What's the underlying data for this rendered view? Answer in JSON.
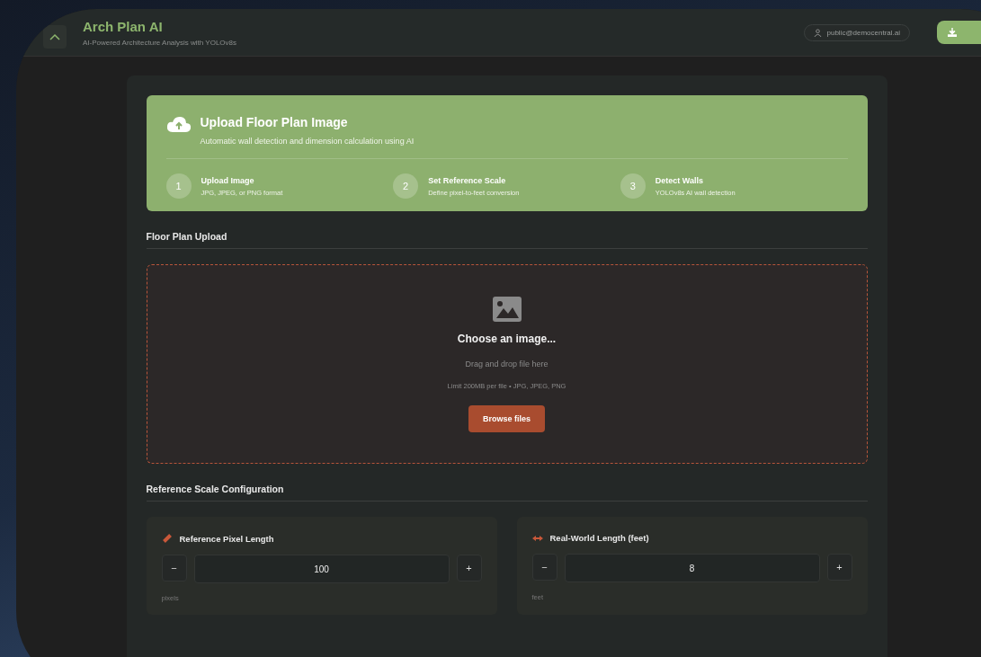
{
  "header": {
    "title": "Arch Plan AI",
    "subtitle": "AI-Powered Architecture Analysis with YOLOv8s",
    "user": "public@democentral.ai"
  },
  "hero": {
    "title": "Upload Floor Plan Image",
    "subtitle": "Automatic wall detection and dimension calculation using AI",
    "steps": [
      {
        "number": "1",
        "title": "Upload Image",
        "detail": "JPG, JPEG, or PNG format"
      },
      {
        "number": "2",
        "title": "Set Reference Scale",
        "detail": "Define pixel-to-feet conversion"
      },
      {
        "number": "3",
        "title": "Detect Walls",
        "detail": "YOLOv8s AI wall detection"
      }
    ]
  },
  "upload": {
    "heading": "Floor Plan Upload",
    "prompt": "Choose an image...",
    "hint": "Drag and drop file here",
    "limit": "Limit 200MB per file • JPG, JPEG, PNG",
    "button": "Browse files"
  },
  "scale": {
    "heading": "Reference Scale Configuration",
    "fields": [
      {
        "kind": "ruler",
        "label": "Reference Pixel Length",
        "value": "100",
        "unit": "pixels",
        "minus": "−",
        "plus": "+"
      },
      {
        "kind": "arrows",
        "label": "Real-World Length (feet)",
        "value": "8",
        "unit": "feet",
        "minus": "−",
        "plus": "+"
      }
    ]
  }
}
